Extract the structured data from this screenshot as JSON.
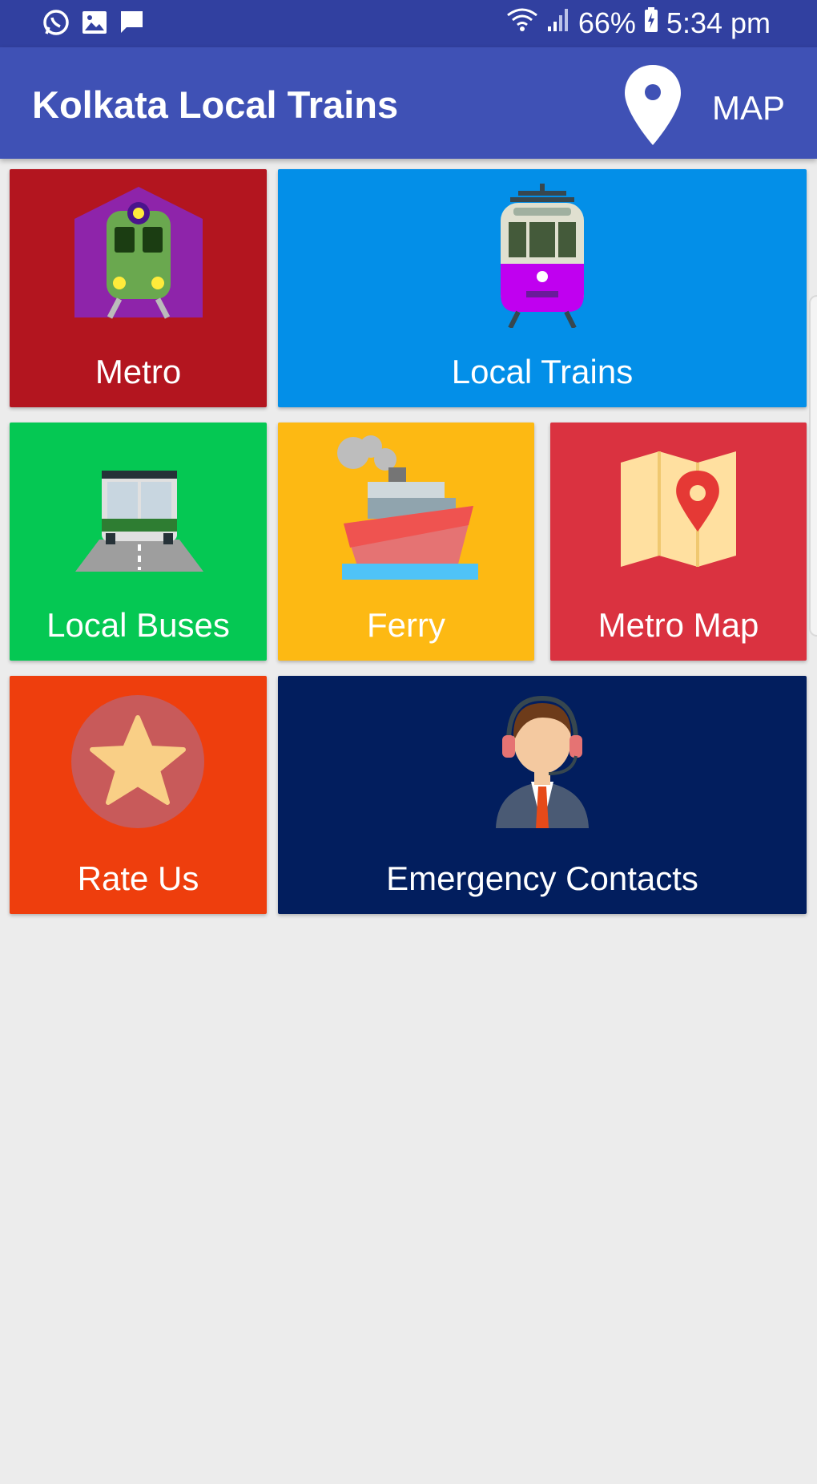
{
  "status_bar": {
    "battery": "66%",
    "time": "5:34 pm",
    "icons": [
      "whatsapp-icon",
      "gallery-icon",
      "message-icon",
      "wifi-icon",
      "signal-icon",
      "battery-icon"
    ]
  },
  "app_bar": {
    "title": "Kolkata Local Trains",
    "map_label": "MAP",
    "color": "#3f51b5"
  },
  "tiles": [
    {
      "label": "Metro",
      "color": "#b3151f",
      "icon": "metro-train-icon"
    },
    {
      "label": "Local Trains",
      "color": "#038fe8",
      "icon": "tram-icon"
    },
    {
      "label": "Local Buses",
      "color": "#05c853",
      "icon": "bus-icon"
    },
    {
      "label": "Ferry",
      "color": "#fdb913",
      "icon": "ship-icon"
    },
    {
      "label": "Metro Map",
      "color": "#da3240",
      "icon": "folded-map-icon"
    },
    {
      "label": "Rate Us",
      "color": "#ee3e0d",
      "icon": "star-icon"
    },
    {
      "label": "Emergency Contacts",
      "color": "#021e5e",
      "icon": "support-agent-icon"
    }
  ]
}
